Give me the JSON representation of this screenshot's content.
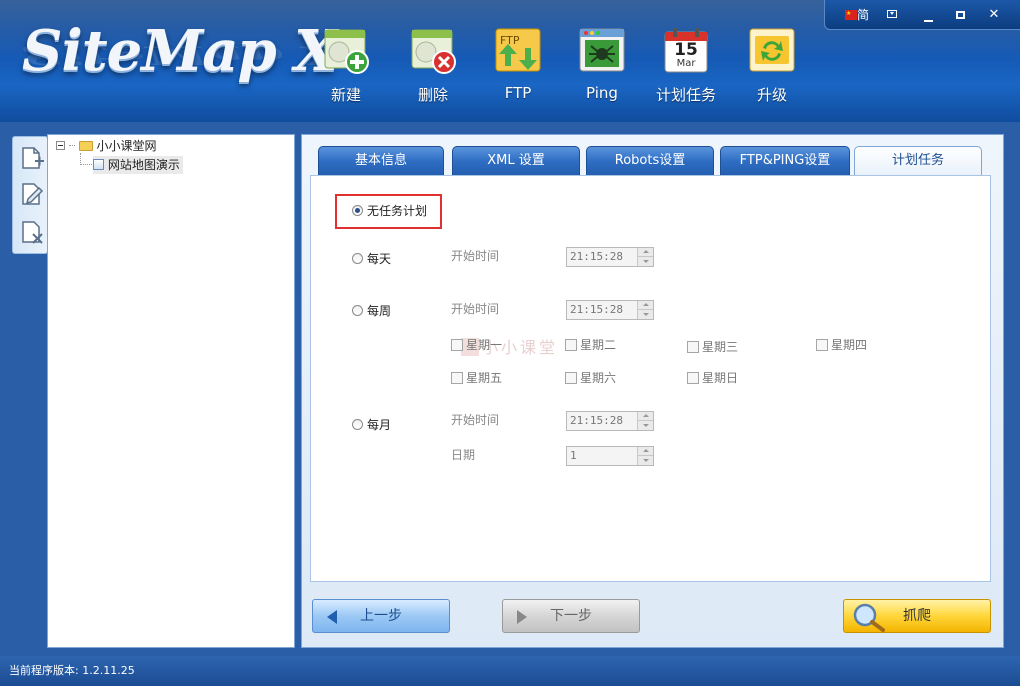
{
  "app": {
    "logo_text": "SiteMap X",
    "lang_badge": "简"
  },
  "toolbar": {
    "items": [
      {
        "label": "新建",
        "icon": "new-site-icon"
      },
      {
        "label": "删除",
        "icon": "delete-site-icon"
      },
      {
        "label": "FTP",
        "icon": "ftp-icon"
      },
      {
        "label": "Ping",
        "icon": "ping-icon"
      },
      {
        "label": "计划任务",
        "icon": "calendar-icon",
        "icon_day": "15",
        "icon_month": "Mar"
      },
      {
        "label": "升级",
        "icon": "update-icon"
      }
    ]
  },
  "window_controls": [
    "flag-icon",
    "menu-icon",
    "minimize-icon",
    "maximize-icon",
    "close-icon"
  ],
  "left_tools": [
    "add-page-icon",
    "edit-page-icon",
    "remove-page-icon"
  ],
  "tree": {
    "root": "小小课堂网",
    "child": "网站地图演示"
  },
  "tabs": [
    {
      "label": "基本信息",
      "active": false
    },
    {
      "label": "XML 设置",
      "active": false
    },
    {
      "label": "Robots设置",
      "active": false
    },
    {
      "label": "FTP&PING设置",
      "active": false
    },
    {
      "label": "计划任务",
      "active": true
    }
  ],
  "schedule": {
    "none_label": "无任务计划",
    "daily_label": "每天",
    "weekly_label": "每周",
    "monthly_label": "每月",
    "start_time_label": "开始时间",
    "date_label": "日期",
    "daily_time": "21:15:28",
    "weekly_time": "21:15:28",
    "monthly_time": "21:15:28",
    "monthly_day": "1",
    "selected": "none",
    "weekdays": [
      "星期一",
      "星期二",
      "星期三",
      "星期四",
      "星期五",
      "星期六",
      "星期日"
    ]
  },
  "watermark": "小小课堂",
  "buttons": {
    "prev": "上一步",
    "next": "下一步",
    "crawl": "抓爬"
  },
  "status": {
    "version_label": "当前程序版本:",
    "version": "1.2.11.25"
  },
  "colors": {
    "accent": "#1a66c4",
    "highlight": "#e03030",
    "crawl": "#ffd63a"
  }
}
